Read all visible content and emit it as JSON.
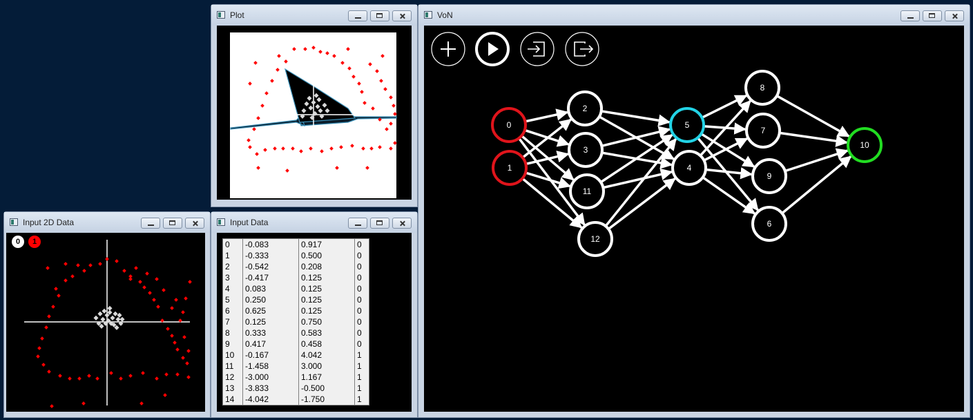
{
  "windows": {
    "plot": {
      "title": "Plot"
    },
    "input2d": {
      "title": "Input 2D Data",
      "legend": [
        "0",
        "1"
      ]
    },
    "inputdata": {
      "title": "Input Data"
    },
    "von": {
      "title": "VoN"
    }
  },
  "toolbar": {
    "add_icon": "plus-icon",
    "run_icon": "play-icon",
    "import_icon": "import-icon",
    "export_icon": "export-icon"
  },
  "colors": {
    "desktop": "#041c38",
    "class0": "#d9d9d9",
    "class1": "#ff0000",
    "input_node": "#e0141b",
    "hidden_node": "#ffffff",
    "selected_node": "#22d3e6",
    "output_node": "#22dd22"
  },
  "table": {
    "rows": [
      [
        "0",
        "-0.083",
        "0.917",
        "0"
      ],
      [
        "1",
        "-0.333",
        "0.500",
        "0"
      ],
      [
        "2",
        "-0.542",
        "0.208",
        "0"
      ],
      [
        "3",
        "-0.417",
        "0.125",
        "0"
      ],
      [
        "4",
        "0.083",
        "0.125",
        "0"
      ],
      [
        "5",
        "0.250",
        "0.125",
        "0"
      ],
      [
        "6",
        "0.625",
        "0.125",
        "0"
      ],
      [
        "7",
        "0.125",
        "0.750",
        "0"
      ],
      [
        "8",
        "0.333",
        "0.583",
        "0"
      ],
      [
        "9",
        "0.417",
        "0.458",
        "0"
      ],
      [
        "10",
        "-0.167",
        "4.042",
        "1"
      ],
      [
        "11",
        "-1.458",
        "3.000",
        "1"
      ],
      [
        "12",
        "-3.000",
        "1.167",
        "1"
      ],
      [
        "13",
        "-3.833",
        "-0.500",
        "1"
      ],
      [
        "14",
        "-4.042",
        "-1.750",
        "1"
      ]
    ]
  },
  "network": {
    "nodes": [
      {
        "id": "0",
        "role": "input"
      },
      {
        "id": "1",
        "role": "input"
      },
      {
        "id": "2",
        "role": "hidden"
      },
      {
        "id": "3",
        "role": "hidden"
      },
      {
        "id": "11",
        "role": "hidden"
      },
      {
        "id": "12",
        "role": "hidden"
      },
      {
        "id": "5",
        "role": "selected"
      },
      {
        "id": "4",
        "role": "hidden"
      },
      {
        "id": "8",
        "role": "hidden"
      },
      {
        "id": "7",
        "role": "hidden"
      },
      {
        "id": "9",
        "role": "hidden"
      },
      {
        "id": "6",
        "role": "hidden"
      },
      {
        "id": "10",
        "role": "output"
      }
    ],
    "edges": [
      [
        "0",
        "2"
      ],
      [
        "0",
        "3"
      ],
      [
        "0",
        "11"
      ],
      [
        "0",
        "12"
      ],
      [
        "1",
        "2"
      ],
      [
        "1",
        "3"
      ],
      [
        "1",
        "11"
      ],
      [
        "1",
        "12"
      ],
      [
        "2",
        "5"
      ],
      [
        "2",
        "4"
      ],
      [
        "3",
        "5"
      ],
      [
        "3",
        "4"
      ],
      [
        "11",
        "5"
      ],
      [
        "11",
        "4"
      ],
      [
        "12",
        "5"
      ],
      [
        "12",
        "4"
      ],
      [
        "5",
        "8"
      ],
      [
        "5",
        "7"
      ],
      [
        "5",
        "9"
      ],
      [
        "5",
        "6"
      ],
      [
        "4",
        "8"
      ],
      [
        "4",
        "7"
      ],
      [
        "4",
        "9"
      ],
      [
        "4",
        "6"
      ],
      [
        "8",
        "10"
      ],
      [
        "7",
        "10"
      ],
      [
        "9",
        "10"
      ],
      [
        "6",
        "10"
      ]
    ]
  }
}
